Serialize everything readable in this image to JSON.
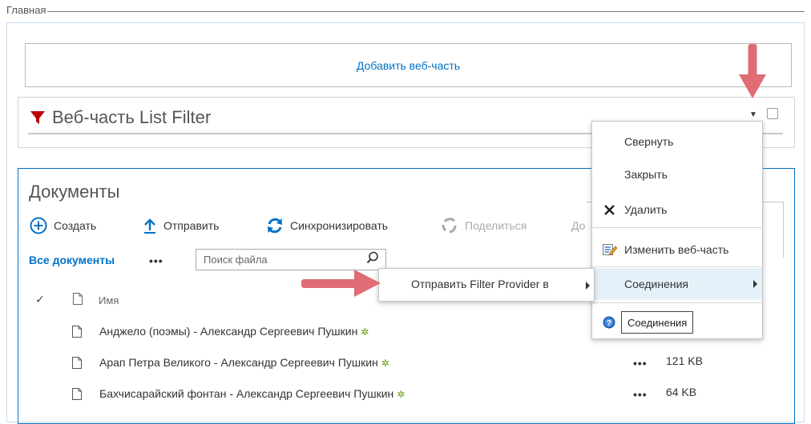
{
  "zone": {
    "title": "Главная"
  },
  "add_webpart": {
    "label": "Добавить веб-часть"
  },
  "list_filter": {
    "title": "Веб-часть List Filter",
    "menu_arrow": "▼"
  },
  "documents": {
    "title": "Документы",
    "commands": [
      {
        "label": "Создать",
        "icon": "plus-circle-icon"
      },
      {
        "label": "Отправить",
        "icon": "upload-arrow-icon"
      },
      {
        "label": "Синхронизировать",
        "icon": "sync-icon"
      },
      {
        "label": "Поделиться",
        "icon": "share-icon",
        "disabled": true
      },
      {
        "label": "До"
      }
    ],
    "view_label": "Все документы",
    "view_more": "•••",
    "search_placeholder": "Поиск файла",
    "column_check": "✓",
    "column_name": "Имя",
    "new_marker": "✲",
    "rows": [
      {
        "name": "Анджело (поэмы) - Александр Сергеевич Пушкин",
        "dots": "",
        "size": ""
      },
      {
        "name": "Арап Петра Великого - Александр Сергеевич Пушкин",
        "dots": "•••",
        "size": "121 KB"
      },
      {
        "name": "Бахчисарайский фонтан - Александр Сергеевич Пушкин",
        "dots": "•••",
        "size": "64 KB"
      }
    ]
  },
  "context_menu": {
    "items": [
      {
        "label": "Свернуть"
      },
      {
        "label": "Закрыть"
      },
      {
        "label": "Удалить",
        "icon": "close-x-icon"
      },
      {
        "label": "Изменить веб-часть",
        "icon": "edit-webpart-icon"
      },
      {
        "label": "Соединения",
        "icon": "",
        "submenu": true
      },
      {
        "label": "",
        "icon": "help-icon"
      }
    ]
  },
  "tooltip": {
    "text": "Соединения"
  },
  "submenu": {
    "label": "Отправить Filter Provider в"
  },
  "colors": {
    "accent": "#0072c6",
    "annotation_arrow": "#e06c75",
    "funnel": "#c00000",
    "new_star": "#5aa000"
  }
}
